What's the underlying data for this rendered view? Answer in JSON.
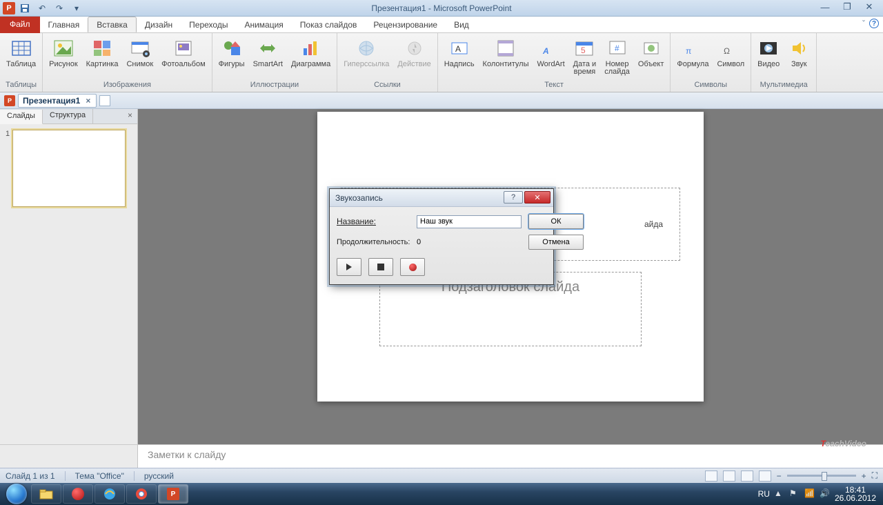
{
  "titlebar": {
    "app_title": "Презентация1 - Microsoft PowerPoint"
  },
  "menu": {
    "file": "Файл",
    "tabs": [
      "Главная",
      "Вставка",
      "Дизайн",
      "Переходы",
      "Анимация",
      "Показ слайдов",
      "Рецензирование",
      "Вид"
    ],
    "active_index": 1
  },
  "ribbon": {
    "groups": [
      {
        "label": "Таблицы",
        "items": [
          {
            "name": "Таблица",
            "icon": "table"
          }
        ]
      },
      {
        "label": "Изображения",
        "items": [
          {
            "name": "Рисунок",
            "icon": "picture"
          },
          {
            "name": "Картинка",
            "icon": "clipart"
          },
          {
            "name": "Снимок",
            "icon": "screenshot"
          },
          {
            "name": "Фотоальбом",
            "icon": "album"
          }
        ]
      },
      {
        "label": "Иллюстрации",
        "items": [
          {
            "name": "Фигуры",
            "icon": "shapes"
          },
          {
            "name": "SmartArt",
            "icon": "smartart"
          },
          {
            "name": "Диаграмма",
            "icon": "chart"
          }
        ]
      },
      {
        "label": "Ссылки",
        "items": [
          {
            "name": "Гиперссылка",
            "icon": "link",
            "disabled": true
          },
          {
            "name": "Действие",
            "icon": "action",
            "disabled": true
          }
        ]
      },
      {
        "label": "Текст",
        "items": [
          {
            "name": "Надпись",
            "icon": "textbox"
          },
          {
            "name": "Колонтитулы",
            "icon": "headerfooter"
          },
          {
            "name": "WordArt",
            "icon": "wordart"
          },
          {
            "name": "Дата и\nвремя",
            "icon": "datetime"
          },
          {
            "name": "Номер\nслайда",
            "icon": "slidenum"
          },
          {
            "name": "Объект",
            "icon": "object"
          }
        ]
      },
      {
        "label": "Символы",
        "items": [
          {
            "name": "Формула",
            "icon": "equation"
          },
          {
            "name": "Символ",
            "icon": "symbol"
          }
        ]
      },
      {
        "label": "Мультимедиа",
        "items": [
          {
            "name": "Видео",
            "icon": "video"
          },
          {
            "name": "Звук",
            "icon": "audio"
          }
        ]
      }
    ]
  },
  "docbar": {
    "doc_name": "Презентация1"
  },
  "sidepane": {
    "tabs": [
      "Слайды",
      "Структура"
    ],
    "active": 0,
    "thumbs": [
      {
        "num": "1"
      }
    ]
  },
  "slide": {
    "title_hint_partial": "айда",
    "subtitle_hint": "Подзаголовок слайда"
  },
  "notes": {
    "placeholder": "Заметки к слайду"
  },
  "watermark": {
    "prefix": "T",
    "text": "eachVideo"
  },
  "status": {
    "slide_pos": "Слайд 1 из 1",
    "theme": "Тема \"Office\"",
    "lang": "русский"
  },
  "taskbar": {
    "lang": "RU",
    "time": "18:41",
    "date": "26.06.2012"
  },
  "dialog": {
    "title": "Звукозапись",
    "name_label": "Название:",
    "name_value": "Наш звук",
    "duration_label": "Продолжительность:",
    "duration_value": "0",
    "ok": "ОК",
    "cancel": "Отмена"
  }
}
